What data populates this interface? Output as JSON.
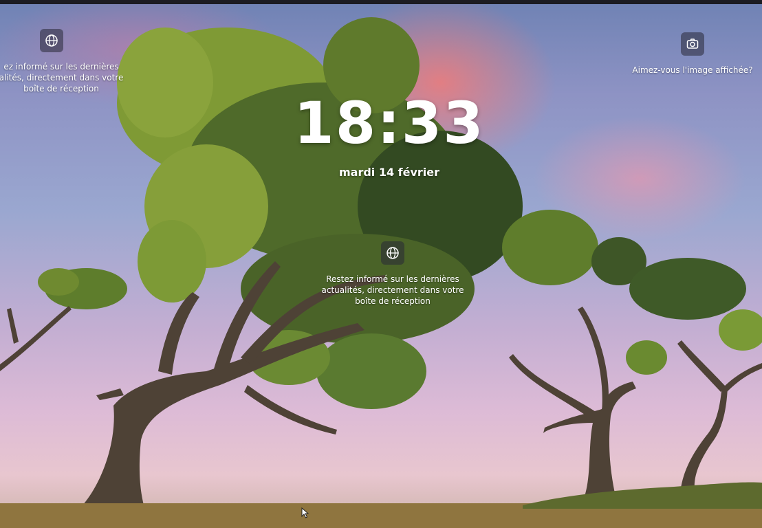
{
  "lockscreen": {
    "time": "18:33",
    "date": "mardi 14 février",
    "left_widget": {
      "icon": "globe-icon",
      "lines": [
        "ez informé sur les dernières",
        "alités, directement dans votre",
        "boîte de réception"
      ]
    },
    "center_widget": {
      "icon": "globe-icon",
      "lines": [
        "Restez informé sur les dernières",
        "actualités, directement dans votre",
        "boîte de réception"
      ]
    },
    "right_widget": {
      "icon": "camera-icon",
      "label": "Aimez-vous l'image affichée?"
    }
  },
  "colors": {
    "sky_top": "#6f82b4",
    "sky_glow": "#ff786e",
    "foliage": "#6f8a2e",
    "trunk": "#4e4236",
    "ground": "#8a6f3c"
  }
}
